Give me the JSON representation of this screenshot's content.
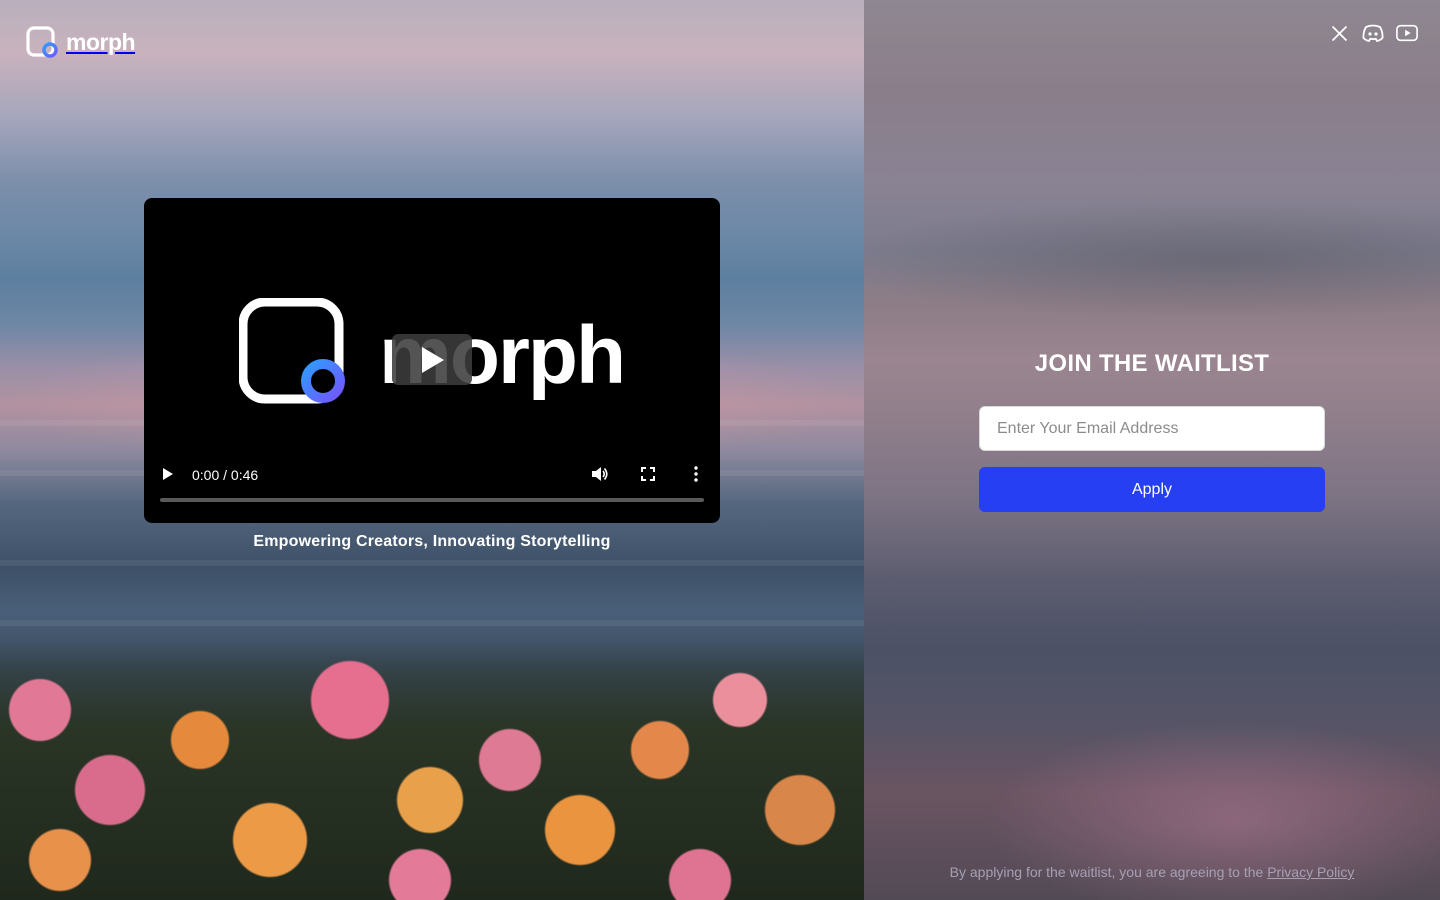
{
  "brand": {
    "name": "morph",
    "accent_color": "#263ff2",
    "logo_gradient": [
      "#2f9bff",
      "#6b5cff"
    ]
  },
  "video": {
    "poster_wordmark": "morph",
    "current_time": "0:00",
    "duration": "0:46",
    "time_label": "0:00 / 0:46",
    "progress": 0,
    "controls": [
      "play-icon",
      "volume-icon",
      "fullscreen-icon",
      "more-options-icon"
    ]
  },
  "tagline": "Empowering Creators, Innovating Storytelling",
  "social": [
    "x-icon",
    "discord-icon",
    "youtube-icon"
  ],
  "waitlist": {
    "title": "JOIN THE WAITLIST",
    "email_placeholder": "Enter Your Email Address",
    "email_value": "",
    "apply_label": "Apply",
    "legal_prefix": "By applying for the waitlist, you are agreeing to the ",
    "privacy_link": "Privacy Policy"
  }
}
